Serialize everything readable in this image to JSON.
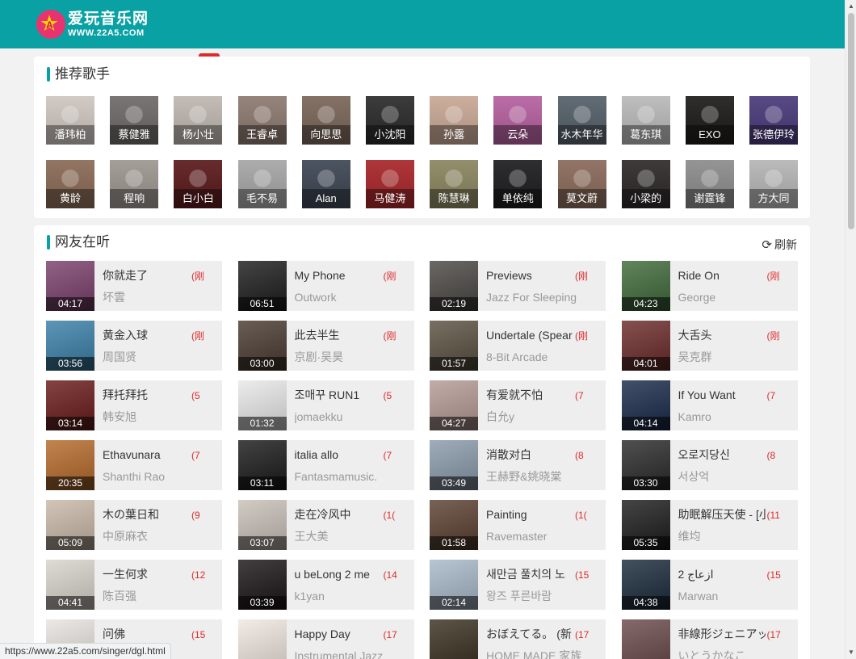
{
  "brand": {
    "name_cn": "爱玩音乐网",
    "name_en": "WWW.22A5.COM",
    "logo_letter": "A"
  },
  "colors": {
    "header": "#0aa1a5",
    "accent": "#0aa1a5",
    "tag": "#e02a2a"
  },
  "recommended": {
    "title": "推荐歌手",
    "artists": [
      {
        "name": "潘玮柏",
        "bg": "#cfc6c0"
      },
      {
        "name": "蔡健雅",
        "bg": "#6e6a68"
      },
      {
        "name": "杨小壮",
        "bg": "#bfb7b0"
      },
      {
        "name": "王睿卓",
        "bg": "#8d7a70"
      },
      {
        "name": "向思思",
        "bg": "#7a6659"
      },
      {
        "name": "小沈阳",
        "bg": "#2b2b2b"
      },
      {
        "name": "孙露",
        "bg": "#c9a895"
      },
      {
        "name": "云朵",
        "bg": "#b5609f"
      },
      {
        "name": "水木年华",
        "bg": "#55606a"
      },
      {
        "name": "葛东琪",
        "bg": "#b9b9b9"
      },
      {
        "name": "EXO",
        "bg": "#1e1c1a"
      },
      {
        "name": "张德伊玲",
        "bg": "#4a3a7a"
      },
      {
        "name": "黄龄",
        "bg": "#8a6a55"
      },
      {
        "name": "程响",
        "bg": "#9d9690"
      },
      {
        "name": "白小白",
        "bg": "#5a1a1c"
      },
      {
        "name": "毛不易",
        "bg": "#a6a6a6"
      },
      {
        "name": "Alan",
        "bg": "#3e4654"
      },
      {
        "name": "马健涛",
        "bg": "#a8262a"
      },
      {
        "name": "陈慧琳",
        "bg": "#8a8660"
      },
      {
        "name": "单依纯",
        "bg": "#1d1d1f"
      },
      {
        "name": "莫文蔚",
        "bg": "#8a6a5a"
      },
      {
        "name": "小梁的",
        "bg": "#2e2a2a"
      },
      {
        "name": "谢霆锋",
        "bg": "#8c8c8c"
      },
      {
        "name": "方大同",
        "bg": "#b5b5b5"
      }
    ]
  },
  "listening": {
    "title": "网友在听",
    "refresh_label": "刷新",
    "songs": [
      {
        "title": "你就走了",
        "tag": "(刚",
        "artist": "坏雲",
        "duration": "04:17",
        "bg": "#7a3f6c"
      },
      {
        "title": "My Phone",
        "tag": "(刚",
        "artist": "Outwork",
        "duration": "06:51",
        "bg": "#1c1c1c"
      },
      {
        "title": "Previews",
        "tag": "(刚",
        "artist": "Jazz For Sleeping",
        "duration": "02:19",
        "bg": "#4a4744"
      },
      {
        "title": "Ride On",
        "tag": "(刚",
        "artist": "George",
        "duration": "04:23",
        "bg": "#3f6a3a"
      },
      {
        "title": "黄金入球",
        "tag": "(刚",
        "artist": "周国贤",
        "duration": "03:56",
        "bg": "#3a7fa8"
      },
      {
        "title": "此去半生",
        "tag": "(刚",
        "artist": "京剧·吴昊",
        "duration": "03:00",
        "bg": "#4a3a30"
      },
      {
        "title": "Undertale (Spear",
        "tag": "(刚",
        "artist": "8-Bit Arcade",
        "duration": "01:57",
        "bg": "#5a5040"
      },
      {
        "title": "大舌头",
        "tag": "(刚",
        "artist": "吴克群",
        "duration": "04:01",
        "bg": "#6a2a2a"
      },
      {
        "title": "拜托拜托",
        "tag": "(5",
        "artist": "韩安旭",
        "duration": "03:14",
        "bg": "#6a1a1a"
      },
      {
        "title": "조매꾸 RUN1",
        "tag": "(5",
        "artist": "jomaekku",
        "duration": "01:32",
        "bg": "#e8e8e8"
      },
      {
        "title": "有爱就不怕",
        "tag": "(7",
        "artist": "白允y",
        "duration": "04:27",
        "bg": "#b59a95"
      },
      {
        "title": "If You Want",
        "tag": "(7",
        "artist": "Kamro",
        "duration": "04:14",
        "bg": "#1a2a4a"
      },
      {
        "title": "Ethavunara",
        "tag": "(7",
        "artist": "Shanthi Rao",
        "duration": "20:35",
        "bg": "#b56a2a"
      },
      {
        "title": "italia allo",
        "tag": "(7",
        "artist": "Fantasmamusic.",
        "duration": "03:11",
        "bg": "#1a1a1a"
      },
      {
        "title": "消散对白",
        "tag": "(8",
        "artist": "王赫野&姚晓棠",
        "duration": "03:49",
        "bg": "#8a9aaa"
      },
      {
        "title": "오로지당신",
        "tag": "(8",
        "artist": "서상억",
        "duration": "03:30",
        "bg": "#2a2a2a"
      },
      {
        "title": "木の葉日和",
        "tag": "(9",
        "artist": "中原麻衣",
        "duration": "05:09",
        "bg": "#c9b8a8"
      },
      {
        "title": "走在冷风中",
        "tag": "(1(",
        "artist": "王大美",
        "duration": "03:07",
        "bg": "#c8c0b8"
      },
      {
        "title": "Painting",
        "tag": "(1(",
        "artist": "Ravemaster",
        "duration": "01:58",
        "bg": "#5a4030"
      },
      {
        "title": "助眠解压天使 - [小",
        "tag": "(11",
        "artist": "维均",
        "duration": "05:35",
        "bg": "#1c1c1c"
      },
      {
        "title": "一生何求",
        "tag": "(12",
        "artist": "陈百强",
        "duration": "04:41",
        "bg": "#d8d4cc"
      },
      {
        "title": "u beLong 2 me",
        "tag": "(14",
        "artist": "k1yan",
        "duration": "03:39",
        "bg": "#1a1416"
      },
      {
        "title": "새만금 풀치의 노",
        "tag": "(15",
        "artist": "왕즈 푸른바람",
        "duration": "02:14",
        "bg": "#a8b8c8"
      },
      {
        "title": "2 ازعاج",
        "tag": "(15",
        "artist": "Marwan",
        "duration": "04:38",
        "bg": "#1a2a3a"
      },
      {
        "title": "问佛",
        "tag": "(15",
        "artist": "",
        "duration": "",
        "bg": "#e8e4e0"
      },
      {
        "title": "Happy Day",
        "tag": "(17",
        "artist": "Instrumental Jazz",
        "duration": "",
        "bg": "#f0e8e0"
      },
      {
        "title": "おぼえてる。 (新",
        "tag": "(17",
        "artist": "HOME MADE 家族",
        "duration": "",
        "bg": "#3a3020"
      },
      {
        "title": "非線形ジェニアッ",
        "tag": "(17",
        "artist": "いとうかなこ",
        "duration": "",
        "bg": "#6a4a4a"
      }
    ]
  },
  "status_url": "https://www.22a5.com/singer/dgl.html"
}
